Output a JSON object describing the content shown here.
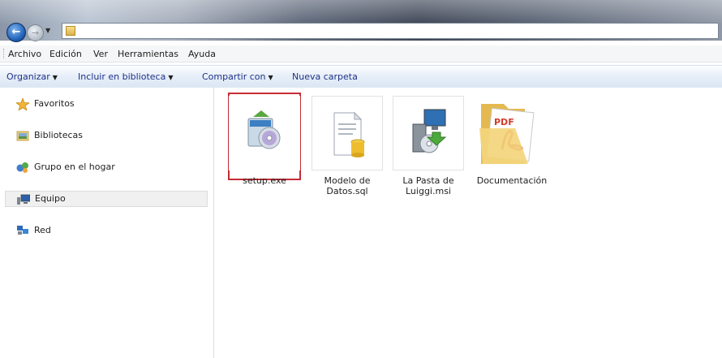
{
  "menu": [
    "Archivo",
    "Edición",
    "Ver",
    "Herramientas",
    "Ayuda"
  ],
  "toolbar": {
    "organize": "Organizar",
    "include_library": "Incluir en biblioteca",
    "share_with": "Compartir con",
    "new_folder": "Nueva carpeta"
  },
  "navigation": [
    {
      "label": "Favoritos",
      "icon": "star-icon"
    },
    {
      "label": "Bibliotecas",
      "icon": "library-icon"
    },
    {
      "label": "Grupo en el hogar",
      "icon": "homegroup-icon"
    },
    {
      "label": "Equipo",
      "icon": "computer-icon",
      "selected": true
    },
    {
      "label": "Red",
      "icon": "network-icon"
    }
  ],
  "files": [
    {
      "name": "setup.exe",
      "icon": "installer-icon",
      "highlighted": true
    },
    {
      "name_line1": "Modelo de",
      "name_line2": "Datos.sql",
      "icon": "sql-file-icon"
    },
    {
      "name_line1": "La Pasta de",
      "name_line2": "Luiggi.msi",
      "icon": "msi-package-icon"
    },
    {
      "name": "Documentación",
      "icon": "pdf-folder-icon"
    }
  ],
  "colors": {
    "highlight": "#c72c35",
    "toolbar_text": "#1e3287"
  }
}
